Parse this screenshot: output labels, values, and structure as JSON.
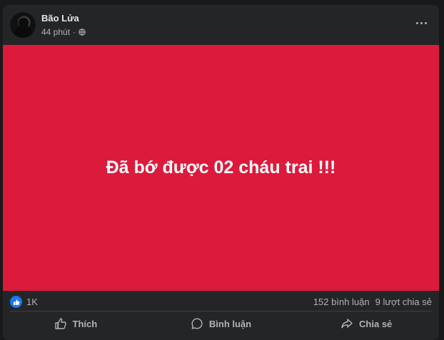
{
  "post": {
    "author": "Bão Lửa",
    "time": "44 phút",
    "separator": "·",
    "privacy_icon": "globe-icon",
    "banner_text": "Đã bớ được 02 cháu trai !!!",
    "banner_color": "#dc1a3c"
  },
  "stats": {
    "likes": "1K",
    "comments": "152 bình luận",
    "shares": "9 lượt chia sẻ"
  },
  "actions": {
    "like": "Thích",
    "comment": "Bình luận",
    "share": "Chia sẻ"
  }
}
